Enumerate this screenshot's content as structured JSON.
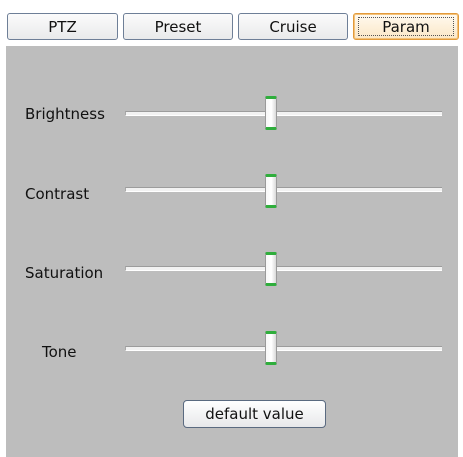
{
  "tabs": [
    {
      "label": "PTZ",
      "active": false
    },
    {
      "label": "Preset",
      "active": false
    },
    {
      "label": "Cruise",
      "active": false
    },
    {
      "label": "Param",
      "active": true
    }
  ],
  "params": [
    {
      "label": "Brightness",
      "value_fraction": 0.46
    },
    {
      "label": "Contrast",
      "value_fraction": 0.46
    },
    {
      "label": "Saturation",
      "value_fraction": 0.46
    },
    {
      "label": "Tone",
      "value_fraction": 0.46
    }
  ],
  "default_button_label": "default value",
  "colors": {
    "panel_bg": "#bdbdbd",
    "active_tab_border": "#e29a3b",
    "thumb_accent": "#2fae3c"
  }
}
